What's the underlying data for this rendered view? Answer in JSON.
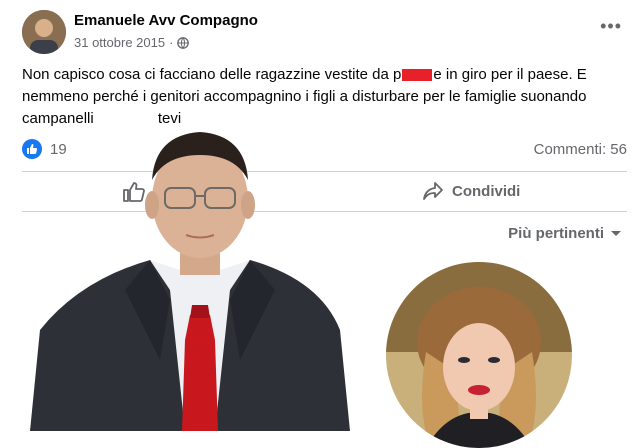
{
  "post": {
    "author": "Emanuele Avv Compagno",
    "date": "31 ottobre 2015",
    "separator": "·",
    "more_label": "•••",
    "text_part1": "Non capisco cosa ci facciano delle ragazzine vestite da p",
    "text_part2": "e in giro per il paese. E nemmeno perché i genitori accompagnino i figli a disturbare per le famiglie suonando campanelli",
    "text_part3": "tevi"
  },
  "stats": {
    "likes": "19",
    "comments": "Commenti: 56"
  },
  "actions": {
    "share_label": "Condividi"
  },
  "sort": {
    "label": "Più pertinenti"
  },
  "colors": {
    "accent": "#1877f2",
    "censor": "#e8202a",
    "secondary_text": "#65676b"
  },
  "icons": [
    "globe-icon",
    "more-icon",
    "like-reaction-icon",
    "thumbs-up-icon",
    "share-icon",
    "chevron-down-icon"
  ]
}
